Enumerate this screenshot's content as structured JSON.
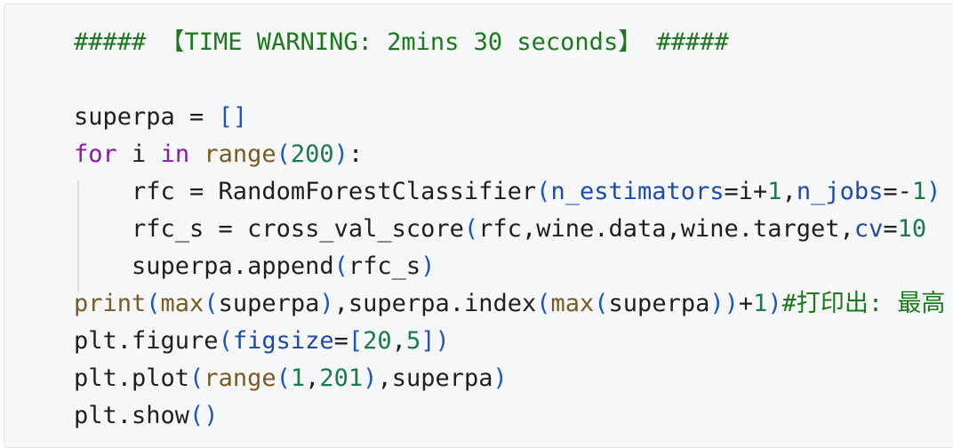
{
  "code": {
    "lines": [
      [
        {
          "t": "##### 【TIME WARNING: 2mins 30 seconds】 #####",
          "c": "comment"
        }
      ],
      [
        {
          "t": "",
          "c": "op"
        }
      ],
      [
        {
          "t": "superpa = ",
          "c": "op"
        },
        {
          "t": "[]",
          "c": "br"
        }
      ],
      [
        {
          "t": "for",
          "c": "kw"
        },
        {
          "t": " i ",
          "c": "op"
        },
        {
          "t": "in",
          "c": "kw"
        },
        {
          "t": " ",
          "c": "op"
        },
        {
          "t": "range",
          "c": "builtin"
        },
        {
          "t": "(",
          "c": "br"
        },
        {
          "t": "200",
          "c": "num"
        },
        {
          "t": ")",
          "c": "br"
        },
        {
          "t": ":",
          "c": "op"
        }
      ],
      [
        {
          "t": "    rfc = RandomForestClassifier",
          "c": "op"
        },
        {
          "t": "(",
          "c": "br"
        },
        {
          "t": "n_estimators",
          "c": "param"
        },
        {
          "t": "=i+",
          "c": "op"
        },
        {
          "t": "1",
          "c": "num"
        },
        {
          "t": ",",
          "c": "op"
        },
        {
          "t": "n_jobs",
          "c": "param"
        },
        {
          "t": "=-",
          "c": "op"
        },
        {
          "t": "1",
          "c": "num"
        },
        {
          "t": ")",
          "c": "br"
        }
      ],
      [
        {
          "t": "    rfc_s = cross_val_score",
          "c": "op"
        },
        {
          "t": "(",
          "c": "br"
        },
        {
          "t": "rfc,wine.data,wine.target,",
          "c": "op"
        },
        {
          "t": "cv",
          "c": "param"
        },
        {
          "t": "=",
          "c": "op"
        },
        {
          "t": "10",
          "c": "num"
        }
      ],
      [
        {
          "t": "    superpa.append",
          "c": "op"
        },
        {
          "t": "(",
          "c": "br"
        },
        {
          "t": "rfc_s",
          "c": "op"
        },
        {
          "t": ")",
          "c": "br"
        }
      ],
      [
        {
          "t": "print",
          "c": "builtin"
        },
        {
          "t": "(",
          "c": "br"
        },
        {
          "t": "max",
          "c": "builtin"
        },
        {
          "t": "(",
          "c": "br"
        },
        {
          "t": "superpa",
          "c": "op"
        },
        {
          "t": ")",
          "c": "br"
        },
        {
          "t": ",superpa.index",
          "c": "op"
        },
        {
          "t": "(",
          "c": "br"
        },
        {
          "t": "max",
          "c": "builtin"
        },
        {
          "t": "(",
          "c": "br"
        },
        {
          "t": "superpa",
          "c": "op"
        },
        {
          "t": "))",
          "c": "br"
        },
        {
          "t": "+",
          "c": "op"
        },
        {
          "t": "1",
          "c": "num"
        },
        {
          "t": ")",
          "c": "br"
        },
        {
          "t": "#打印出: 最高",
          "c": "comment"
        }
      ],
      [
        {
          "t": "plt.figure",
          "c": "op"
        },
        {
          "t": "(",
          "c": "br"
        },
        {
          "t": "figsize",
          "c": "param"
        },
        {
          "t": "=",
          "c": "op"
        },
        {
          "t": "[",
          "c": "br"
        },
        {
          "t": "20",
          "c": "num"
        },
        {
          "t": ",",
          "c": "op"
        },
        {
          "t": "5",
          "c": "num"
        },
        {
          "t": "])",
          "c": "br"
        }
      ],
      [
        {
          "t": "plt.plot",
          "c": "op"
        },
        {
          "t": "(",
          "c": "br"
        },
        {
          "t": "range",
          "c": "builtin"
        },
        {
          "t": "(",
          "c": "br"
        },
        {
          "t": "1",
          "c": "num"
        },
        {
          "t": ",",
          "c": "op"
        },
        {
          "t": "201",
          "c": "num"
        },
        {
          "t": ")",
          "c": "br"
        },
        {
          "t": ",superpa",
          "c": "op"
        },
        {
          "t": ")",
          "c": "br"
        }
      ],
      [
        {
          "t": "plt.show",
          "c": "op"
        },
        {
          "t": "()",
          "c": "br"
        }
      ]
    ]
  },
  "colors": {
    "comment": "#1a7a1a",
    "keyword": "#8a1aa8",
    "builtin": "#7a5a20",
    "number": "#1a7a4a",
    "bracket": "#1a55c8",
    "param": "#1f4aa8"
  }
}
